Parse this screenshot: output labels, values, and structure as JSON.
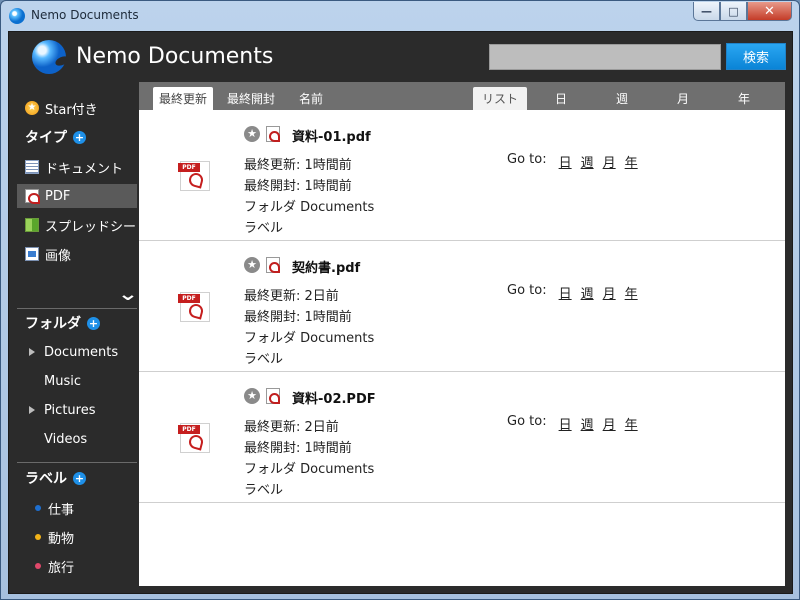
{
  "window": {
    "title": "Nemo Documents",
    "controls": {
      "minimize": "—",
      "maximize": "□",
      "close": "✕"
    }
  },
  "app": {
    "title": "Nemo Documents"
  },
  "search": {
    "value": "",
    "placeholder": "",
    "button_label": "検索"
  },
  "sidebar": {
    "starred": {
      "label": "Star付き",
      "icon": "star-icon"
    },
    "types_header": "タイプ",
    "types": [
      {
        "label": "ドキュメント",
        "icon": "document-icon"
      },
      {
        "label": "PDF",
        "icon": "pdf-icon",
        "selected": true
      },
      {
        "label": "スプレッドシー",
        "icon": "spreadsheet-icon"
      },
      {
        "label": "画像",
        "icon": "image-icon"
      }
    ],
    "folders_header": "フォルダ",
    "folders": [
      {
        "label": "Documents",
        "expandable": true
      },
      {
        "label": "Music",
        "expandable": false
      },
      {
        "label": "Pictures",
        "expandable": true
      },
      {
        "label": "Videos",
        "expandable": false
      }
    ],
    "labels_header": "ラベル",
    "labels": [
      {
        "label": "仕事",
        "color": "#1e6fd0"
      },
      {
        "label": "動物",
        "color": "#f2b318"
      },
      {
        "label": "旅行",
        "color": "#e0486a"
      }
    ]
  },
  "tabs": {
    "sort": [
      "最終更新",
      "最終開封",
      "名前"
    ],
    "views": [
      "リスト",
      "日",
      "週",
      "月",
      "年"
    ]
  },
  "documents": [
    {
      "name": "資料-01.pdf",
      "modified": "最終更新: 1時間前",
      "opened": "最終開封: 1時間前",
      "folder": "フォルダ Documents",
      "label": "ラベル"
    },
    {
      "name": "契約書.pdf",
      "modified": "最終更新: 2日前",
      "opened": "最終開封: 1時間前",
      "folder": "フォルダ Documents",
      "label": "ラベル"
    },
    {
      "name": "資料-02.PDF",
      "modified": "最終更新: 2日前",
      "opened": "最終開封: 1時間前",
      "folder": "フォルダ Documents",
      "label": "ラベル"
    }
  ],
  "goto": {
    "label": "Go to:",
    "links": [
      "日",
      "週",
      "月",
      "年"
    ]
  },
  "icons": {
    "big_pdf_label": "PDF",
    "star_glyph": "★",
    "plus_glyph": "+",
    "chevron_glyph": "⌄"
  },
  "colors": {
    "accent": "#0a84d6",
    "sidebar_bg": "#2b2b2b",
    "tabbar_bg": "#6f6f6f",
    "pdf_red": "#c51e1e"
  }
}
